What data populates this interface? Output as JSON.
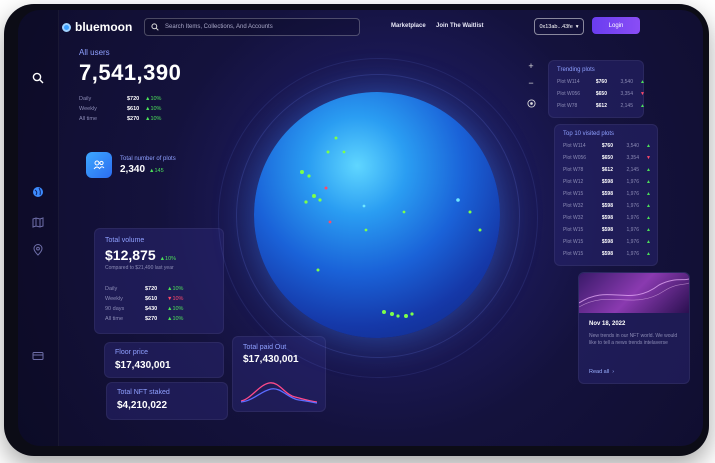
{
  "brand": {
    "name": "bluemoon"
  },
  "search": {
    "placeholder": "Search Items, Collections, And Accounts"
  },
  "nav": {
    "marketplace": "Marketplace",
    "waitlist": "Join The Waitlist"
  },
  "wallet": {
    "address": "0x13ab...43fe",
    "caret": "▾"
  },
  "login": {
    "label": "Login"
  },
  "all_users": {
    "label": "All users",
    "value": "7,541,390",
    "rows": [
      {
        "period": "Daily",
        "value": "$720",
        "change": "▲10%"
      },
      {
        "period": "Weekly",
        "value": "$610",
        "change": "▲10%"
      },
      {
        "period": "All time",
        "value": "$270",
        "change": "▲10%"
      }
    ]
  },
  "total_plots": {
    "label": "Total number of plots",
    "value": "2,340",
    "change": "▲145"
  },
  "total_volume": {
    "label": "Total volume",
    "value": "$12,875",
    "change": "▲10%",
    "sub": "Compared to $21,490 last year",
    "rows": [
      {
        "period": "Daily",
        "value": "$720",
        "change": "▲10%",
        "dir": "up"
      },
      {
        "period": "Weekly",
        "value": "$610",
        "change": "▼10%",
        "dir": "down"
      },
      {
        "period": "90 days",
        "value": "$430",
        "change": "▲10%",
        "dir": "up"
      },
      {
        "period": "All time",
        "value": "$270",
        "change": "▲10%",
        "dir": "up"
      }
    ]
  },
  "floor_price": {
    "label": "Floor price",
    "value": "$17,430,001"
  },
  "nft_staked": {
    "label": "Total NFT staked",
    "value": "$4,210,022"
  },
  "total_paid": {
    "label": "Total paid Out",
    "value": "$17,430,001"
  },
  "trending": {
    "title": "Trending plots",
    "rows": [
      {
        "name": "Plot W114",
        "price": "$760",
        "qty": "3,540",
        "dir": "up"
      },
      {
        "name": "Plot W056",
        "price": "$650",
        "qty": "3,354",
        "dir": "down"
      },
      {
        "name": "Plot W78",
        "price": "$612",
        "qty": "2,145",
        "dir": "up"
      }
    ]
  },
  "top10": {
    "title": "Top 10 visited plots",
    "rows": [
      {
        "name": "Plot W114",
        "price": "$760",
        "qty": "3,540",
        "dir": "up"
      },
      {
        "name": "Plot W056",
        "price": "$650",
        "qty": "3,354",
        "dir": "down"
      },
      {
        "name": "Plot W78",
        "price": "$612",
        "qty": "2,145",
        "dir": "up"
      },
      {
        "name": "Plot W12",
        "price": "$598",
        "qty": "1,976",
        "dir": "up"
      },
      {
        "name": "Plot W15",
        "price": "$598",
        "qty": "1,976",
        "dir": "up"
      },
      {
        "name": "Plot W32",
        "price": "$598",
        "qty": "1,976",
        "dir": "up"
      },
      {
        "name": "Plot W32",
        "price": "$598",
        "qty": "1,976",
        "dir": "up"
      },
      {
        "name": "Plot W15",
        "price": "$598",
        "qty": "1,976",
        "dir": "up"
      },
      {
        "name": "Plot W15",
        "price": "$598",
        "qty": "1,976",
        "dir": "up"
      },
      {
        "name": "Plot W15",
        "price": "$598",
        "qty": "1,976",
        "dir": "up"
      }
    ]
  },
  "news": {
    "date": "Nov 18, 2022",
    "text": "New trends in our NFT world. We would like to tell a news trends intelaverse",
    "read_all": "Read all",
    "arrow": "›"
  },
  "colors": {
    "accent": "#6a3df0",
    "up": "#4ce05a",
    "down": "#ff4a6a",
    "label": "#8fa0ff"
  }
}
